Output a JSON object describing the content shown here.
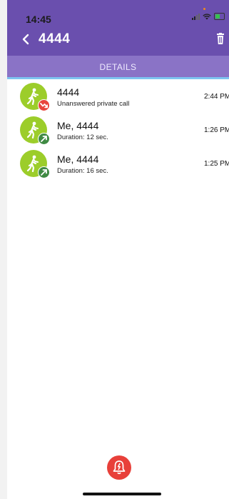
{
  "status_bar": {
    "time": "14:45"
  },
  "nav": {
    "title": "4444"
  },
  "tabs": [
    {
      "label": "DETAILS"
    }
  ],
  "calls": [
    {
      "title": "4444",
      "subtitle": "Unanswered private call",
      "time": "2:44 PM",
      "badge": "missed-call-icon"
    },
    {
      "title": "Me, 4444",
      "subtitle": "Duration: 12 sec.",
      "time": "1:26 PM",
      "badge": "outgoing-call-icon"
    },
    {
      "title": "Me, 4444",
      "subtitle": "Duration: 16 sec.",
      "time": "1:25 PM",
      "badge": "outgoing-call-icon"
    }
  ],
  "colors": {
    "header": "#6a4fae",
    "tab": "#8a73c6",
    "tab_indicator": "#7ec4f0",
    "avatar": "#9ccd2a",
    "missed_badge": "#e8453c",
    "outgoing_badge": "#3f8a43",
    "alarm_button": "#e8403a"
  },
  "icons": {
    "back": "chevron-left-icon",
    "delete": "trash-icon",
    "avatar": "walking-person-icon",
    "alarm": "alarm-bell-icon"
  }
}
